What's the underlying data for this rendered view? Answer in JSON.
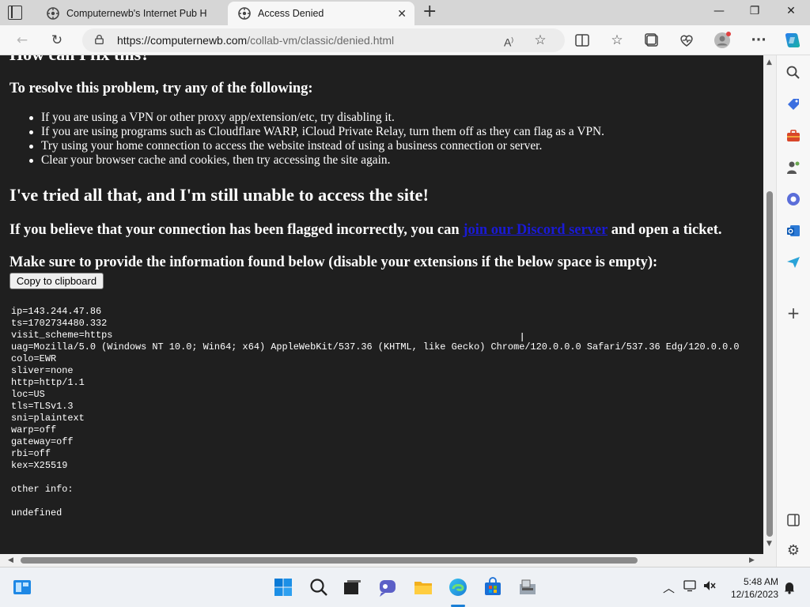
{
  "browser": {
    "tabs": [
      {
        "title": "Computernewb's Internet Pub H",
        "active": false
      },
      {
        "title": "Access Denied",
        "active": true
      }
    ],
    "url_host": "https://computernewb.com",
    "url_path": "/collab-vm/classic/denied.html",
    "icons": [
      "tab-actions-icon",
      "back-icon",
      "refresh-icon",
      "lock-icon",
      "read-aloud-icon",
      "favorite-star-icon",
      "split-screen-icon",
      "favorites-icon",
      "collections-icon",
      "browser-essentials-icon",
      "profile-icon",
      "more-icon",
      "copilot-icon"
    ]
  },
  "page": {
    "cut_heading": "How can I fix this?",
    "resolve_heading": "To resolve this problem, try any of the following:",
    "bullets": [
      "If you are using a VPN or other proxy app/extension/etc, try disabling it.",
      "If you are using programs such as Cloudflare WARP, iCloud Private Relay, turn them off as they can flag as a VPN.",
      "Try using your home connection to access the website instead of using a business connection or server.",
      "Clear your browser cache and cookies, then try accessing the site again."
    ],
    "tried_heading": "I've tried all that, and I'm still unable to access the site!",
    "flag_text_before": "If you believe that your connection has been flagged incorrectly, you can ",
    "flag_link": "join our Discord server",
    "flag_text_after": " and open a ticket.",
    "info_heading": "Make sure to provide the information found below (disable your extensions if the below space is empty):",
    "copy_button": "Copy to clipboard",
    "trace": "ip=143.244.47.86\nts=1702734480.332\nvisit_scheme=https\nuag=Mozilla/5.0 (Windows NT 10.0; Win64; x64) AppleWebKit/537.36 (KHTML, like Gecko) Chrome/120.0.0.0 Safari/537.36 Edg/120.0.0.0\ncolo=EWR\nsliver=none\nhttp=http/1.1\nloc=US\ntls=TLSv1.3\nsni=plaintext\nwarp=off\ngateway=off\nrbi=off\nkex=X25519\n\nother info:\n\nundefined"
  },
  "sidebar": {
    "icons": [
      "search-icon",
      "shopping-icon",
      "tools-icon",
      "games-icon",
      "microsoft-365-icon",
      "outlook-icon",
      "drop-icon",
      "add-icon",
      "sidebar-toggle-icon",
      "settings-icon"
    ]
  },
  "taskbar": {
    "time": "5:48 AM",
    "date": "12/16/2023",
    "icons": [
      "widgets-icon",
      "start-icon",
      "search-icon",
      "task-view-icon",
      "chat-icon",
      "file-explorer-icon",
      "edge-icon",
      "store-icon",
      "app-icon",
      "chevron-up-icon",
      "network-icon",
      "volume-icon",
      "notification-icon"
    ]
  },
  "colors": {
    "page_bg": "#1f1f1f",
    "link": "#1a1ad6",
    "chrome_bg": "#f7f7f7",
    "tabbar_bg": "#d6d6d6",
    "taskbar_bg": "#eef1f5"
  }
}
